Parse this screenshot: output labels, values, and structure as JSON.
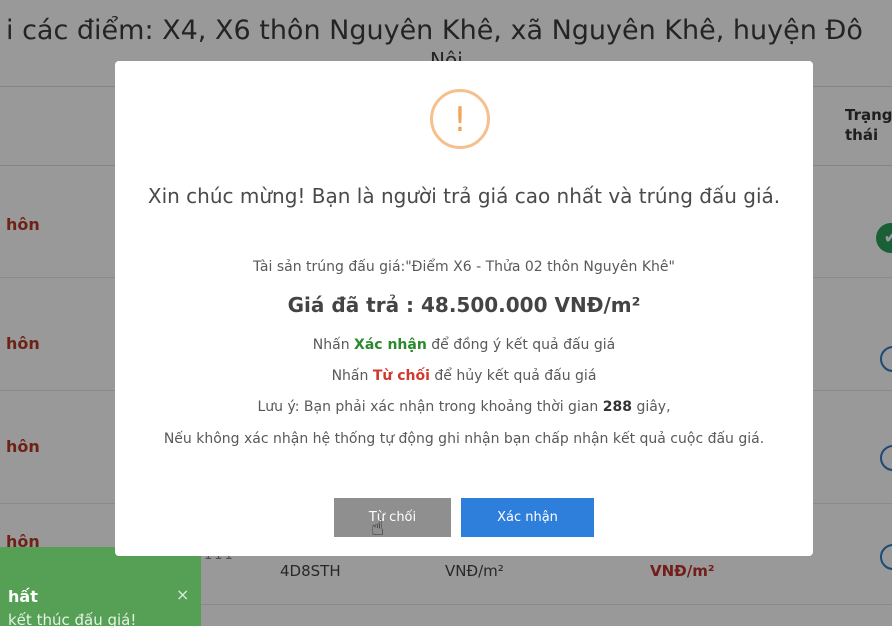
{
  "page": {
    "title_line1": "i các điểm: X4, X6 thôn Nguyên Khê, xã Nguyên Khê, huyện Đô",
    "title_line2": "Nội"
  },
  "table": {
    "status_header": "Trạng thái",
    "rows": [
      {
        "label": "hôn",
        "status": "success"
      },
      {
        "label": "hôn",
        "status": "pending"
      },
      {
        "label": "hôn",
        "status": "pending"
      },
      {
        "label": "hôn",
        "status": "pending"
      }
    ],
    "last_row": {
      "dots": "111",
      "code": "4D8STH",
      "unit": "VNĐ/m²",
      "price_unit": "VNĐ/m²"
    }
  },
  "toast": {
    "title": "hất",
    "message": "kết thúc đấu giá!",
    "close_symbol": "×",
    "color": "#55a055"
  },
  "modal": {
    "icon": "exclamation-icon",
    "heading": "Xin chúc mừng! Bạn là người trả giá cao nhất và trúng đấu giá.",
    "asset_text": "Tài sản trúng đấu giá:\"Điểm X6 - Thửa 02 thôn Nguyên Khê\"",
    "price_text": "Giá đã trả : 48.500.000 VNĐ/m²",
    "instruction_confirm": {
      "prefix": "Nhấn",
      "keyword": "Xác nhận",
      "suffix": "để đồng ý kết quả đấu giá"
    },
    "instruction_reject": {
      "prefix": "Nhấn",
      "keyword": "Từ chối",
      "suffix": "để hủy kết quả đấu giá"
    },
    "note": {
      "prefix": "Lưu ý: Bạn phải xác nhận trong khoảng thời gian",
      "seconds": "288",
      "suffix": "giây,"
    },
    "fallback_text": "Nếu không xác nhận hệ thống tự động ghi nhận bạn chấp nhận kết quả cuộc đấu giá.",
    "buttons": {
      "reject_label": "Từ chối",
      "confirm_label": "Xác nhận"
    },
    "colors": {
      "confirm": "#2d7fdb",
      "reject": "#8f8f8f",
      "icon": "#f2a65b"
    }
  }
}
